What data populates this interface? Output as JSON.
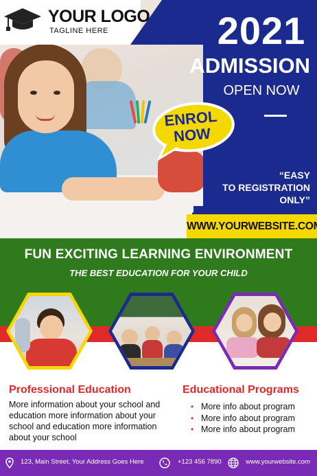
{
  "logo": {
    "name": "YOUR LOGO",
    "tagline": "TAGLINE HERE",
    "icon": "graduation-cap-icon"
  },
  "hero": {
    "year": "2021",
    "title": "ADMISSION",
    "subtitle": "OPEN NOW",
    "bubble": [
      "ENROL",
      "NOW"
    ],
    "quote": [
      "“EASY",
      "TO REGISTRATION",
      "ONLY”"
    ],
    "website": "WWW.YOURWEBSITE.COM"
  },
  "banner": {
    "headline": "FUN EXCITING LEARNING ENVIRONMENT",
    "subheadline": "THE BEST EDUCATION FOR YOUR CHILD"
  },
  "photos": [
    {
      "name": "boy-photo",
      "border_color": "#f5d800"
    },
    {
      "name": "classroom-photo",
      "border_color": "#1b2a8e"
    },
    {
      "name": "girls-photo",
      "border_color": "#7a2bb5"
    }
  ],
  "sections": {
    "professional": {
      "title": "Professional Education",
      "text": "More information about your school and education more information about your school and education more information about your school"
    },
    "programs": {
      "title": "Educational Programs",
      "items": [
        "More info about program",
        "More info about program",
        "More info about program"
      ]
    }
  },
  "footer": {
    "address": "123, Main Street, Your Address Goes Here",
    "phone": "+123 456 7890",
    "website": "www.yourwebsite.com"
  },
  "colors": {
    "blue": "#1b2a8e",
    "yellow": "#f5d800",
    "green": "#2f7a1c",
    "red": "#e02a2a",
    "purple": "#7a2bb5"
  }
}
